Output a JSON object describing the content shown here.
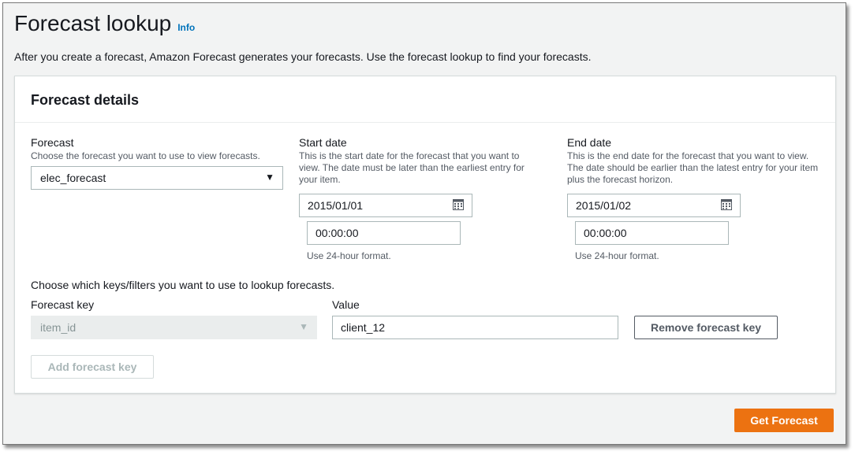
{
  "page": {
    "title": "Forecast lookup",
    "info_link": "Info",
    "description": "After you create a forecast, Amazon Forecast generates your forecasts. Use the forecast lookup to find your forecasts."
  },
  "panel": {
    "title": "Forecast details",
    "forecast": {
      "label": "Forecast",
      "hint": "Choose the forecast you want to use to view forecasts.",
      "selected": "elec_forecast"
    },
    "start_date": {
      "label": "Start date",
      "hint": "This is the start date for the forecast that you want to view. The date must be later than the earliest entry for your item.",
      "date": "2015/01/01",
      "time": "00:00:00",
      "time_hint": "Use 24-hour format."
    },
    "end_date": {
      "label": "End date",
      "hint": "This is the end date for the forecast that you want to view. The date should be earlier than the latest entry for your item plus the forecast horizon.",
      "date": "2015/01/02",
      "time": "00:00:00",
      "time_hint": "Use 24-hour format."
    },
    "keys_heading": "Choose which keys/filters you want to use to lookup forecasts.",
    "forecast_key_label": "Forecast key",
    "value_label": "Value",
    "forecast_key_selected": "item_id",
    "value": "client_12",
    "remove_button": "Remove forecast key",
    "add_button": "Add forecast key"
  },
  "footer": {
    "get_forecast_button": "Get Forecast"
  },
  "colors": {
    "primary": "#ec7211",
    "link": "#0073bb"
  },
  "icons": {
    "calendar": "calendar-icon",
    "dropdown": "caret-down-icon"
  }
}
